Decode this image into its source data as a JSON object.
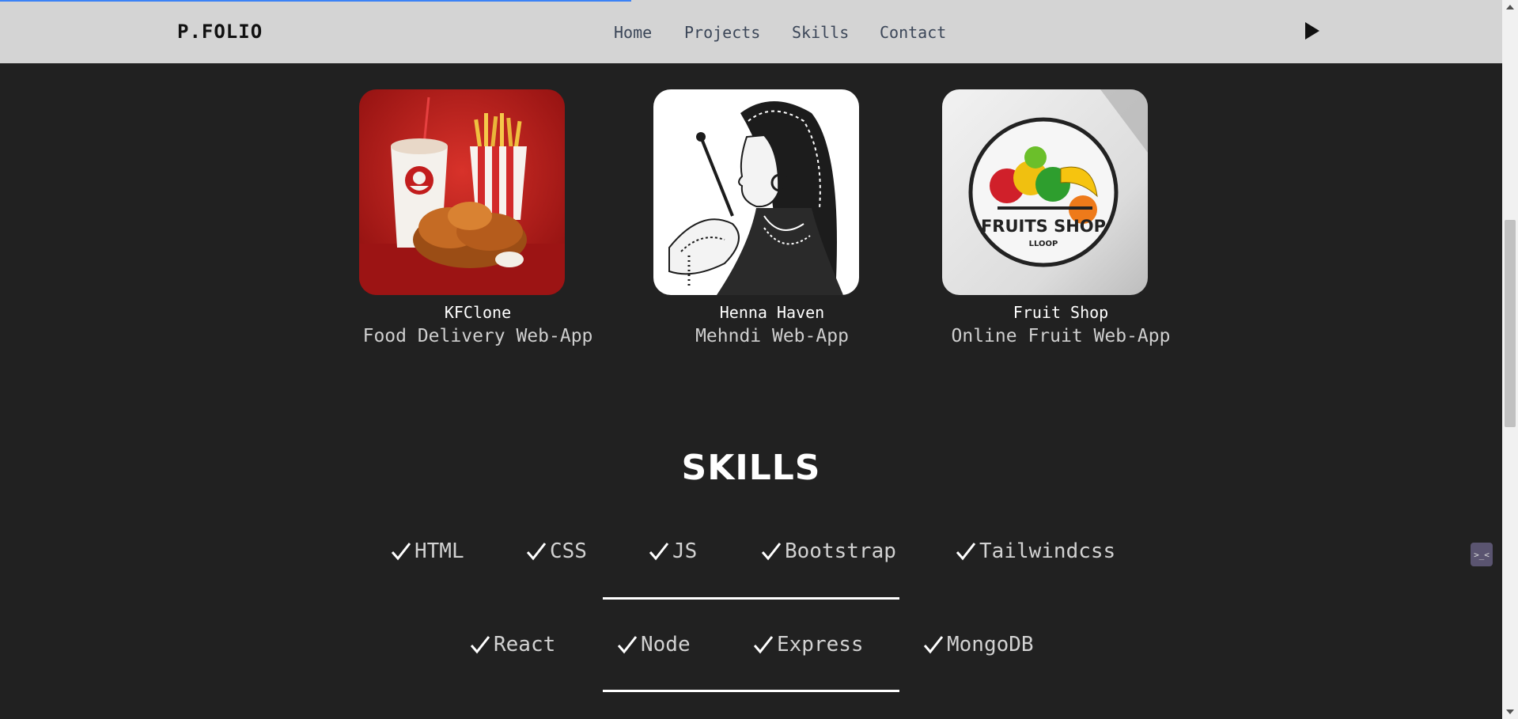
{
  "nav": {
    "brand": "P.FOLIO",
    "links": [
      "Home",
      "Projects",
      "Skills",
      "Contact"
    ]
  },
  "projects": [
    {
      "title": "KFClone",
      "subtitle": "Food Delivery Web-App"
    },
    {
      "title": "Henna Haven",
      "subtitle": "Mehndi Web-App"
    },
    {
      "title": "Fruit Shop",
      "subtitle": "Online Fruit Web-App"
    }
  ],
  "fruit_logo": {
    "line1": "FRUITS SHOP",
    "line2": "LLOOP"
  },
  "skills": {
    "title": "SKILLS",
    "row1": [
      "HTML",
      "CSS",
      "JS",
      "Bootstrap",
      "Tailwindcss"
    ],
    "row2": [
      "React",
      "Node",
      "Express",
      "MongoDB"
    ]
  },
  "widget": {
    "label": ">_<"
  },
  "colors": {
    "background": "#212121",
    "navbar": "#d4d4d4",
    "progress": "#3b82f6"
  }
}
